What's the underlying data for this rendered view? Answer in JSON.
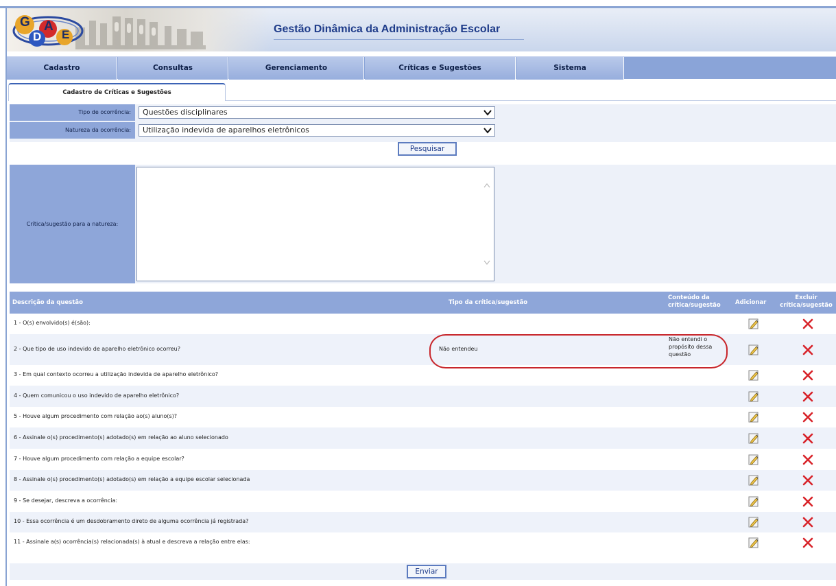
{
  "header": {
    "logo_letters": [
      "G",
      "D",
      "A",
      "E"
    ],
    "title": "Gestão Dinâmica da Administração Escolar"
  },
  "menu": [
    "Cadastro",
    "Consultas",
    "Gerenciamento",
    "Críticas e Sugestões",
    "Sistema"
  ],
  "tab": {
    "label": "Cadastro de Críticas e Sugestões"
  },
  "filters": {
    "tipo_label": "Tipo de ocorrência:",
    "tipo_value": "Questões disciplinares",
    "natureza_label": "Natureza da ocorrência:",
    "natureza_value": "Utilização indevida de aparelhos eletrônicos",
    "search_button": "Pesquisar"
  },
  "critica": {
    "label": "Crítica/sugestão para a natureza:",
    "value": ""
  },
  "table": {
    "headers": {
      "descricao": "Descrição da questão",
      "tipo": "Tipo da crítica/sugestão",
      "conteudo_1": "Conteúdo da",
      "conteudo_2": "crítica/sugestão",
      "adicionar": "Adicionar",
      "excluir_1": "Excluir",
      "excluir_2": "crítica/sugestão"
    },
    "rows": [
      {
        "descricao": "1 - O(s) envolvido(s) é(são):",
        "tipo": "",
        "conteudo": []
      },
      {
        "descricao": "2 - Que tipo de uso indevido de aparelho eletrônico ocorreu?",
        "tipo": "Não entendeu",
        "conteudo": [
          "Não entendi o",
          "propósito dessa",
          "questão"
        ]
      },
      {
        "descricao": "3 - Em qual contexto ocorreu a utilização indevida de aparelho eletrônico?",
        "tipo": "",
        "conteudo": []
      },
      {
        "descricao": "4 - Quem comunicou o uso indevido de aparelho eletrônico?",
        "tipo": "",
        "conteudo": []
      },
      {
        "descricao": "5 - Houve algum procedimento com relação ao(s) aluno(s)?",
        "tipo": "",
        "conteudo": []
      },
      {
        "descricao": "6 - Assinale o(s) procedimento(s) adotado(s) em relação ao aluno selecionado",
        "tipo": "",
        "conteudo": []
      },
      {
        "descricao": "7 - Houve algum procedimento com relação a equipe escolar?",
        "tipo": "",
        "conteudo": []
      },
      {
        "descricao": "8 - Assinale o(s) procedimento(s) adotado(s) em relação a equipe escolar selecionada",
        "tipo": "",
        "conteudo": []
      },
      {
        "descricao": "9 - Se desejar, descreva a ocorrência:",
        "tipo": "",
        "conteudo": []
      },
      {
        "descricao": "10 - Essa ocorrência é um desdobramento direto de alguma ocorrência já registrada?",
        "tipo": "",
        "conteudo": []
      },
      {
        "descricao": "11 - Assinale a(s) ocorrência(s) relacionada(s) à atual e descreva a relação entre elas:",
        "tipo": "",
        "conteudo": []
      }
    ]
  },
  "submit_button": "Enviar",
  "colors": {
    "menu_bg": "#97aedd",
    "label_bg": "#8ea6d9",
    "row_alt": "#eef2fa",
    "title": "#1f3c8a",
    "delete": "#d8232a",
    "annotation": "#c8262b"
  },
  "icons": {
    "add": "pencil-edit-icon",
    "delete": "red-x-icon"
  }
}
